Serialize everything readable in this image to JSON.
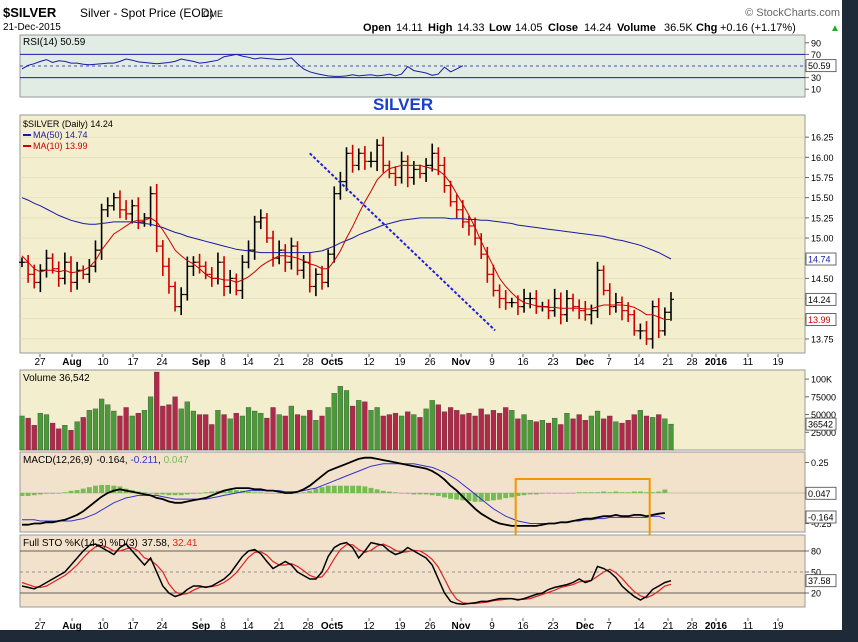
{
  "header": {
    "symbol": "$SILVER",
    "description": "Silver - Spot Price (EOD)",
    "exchange": "CME",
    "date": "21-Dec-2015",
    "copyright": "© StockCharts.com",
    "open_label": "Open",
    "open": "14.11",
    "high_label": "High",
    "high": "14.33",
    "low_label": "Low",
    "low": "14.05",
    "close_label": "Close",
    "close": "14.24",
    "volume_label": "Volume",
    "volume": "36.5K",
    "chg_label": "Chg",
    "chg": "+0.16 (+1.17%)",
    "up_arrow": "▲"
  },
  "annotation": "SILVER",
  "colors": {
    "page_bg": "#ffffff",
    "frame": "#1f2a38",
    "price_up": "#000000",
    "price_down": "#cc0000",
    "ma50": "#1a1aa8",
    "ma10": "#cc0000",
    "trendline": "#1f1fe0",
    "vol_up": "#4a9a3a",
    "vol_down": "#b0284a",
    "macd": "#000000",
    "macd_signal": "#3333cc",
    "macd_hist": "#77bb55",
    "sto_k": "#000000",
    "sto_d": "#dd2222",
    "highlight_box": "#f09800"
  },
  "x_axis_labels": [
    "27",
    "Aug",
    "10",
    "17",
    "24",
    "Sep",
    "8",
    "14",
    "21",
    "28",
    "Oct5",
    "12",
    "19",
    "26",
    "Nov",
    "9",
    "16",
    "23",
    "Dec",
    "7",
    "14",
    "21",
    "28",
    "2016",
    "11",
    "19"
  ],
  "chart_data": [
    {
      "type": "line",
      "title": "RSI(14) 50.59",
      "legend": [
        {
          "name": "RSI(14)",
          "value": "50.59"
        }
      ],
      "y_ticks": [
        "90",
        "70",
        "50",
        "30",
        "10"
      ],
      "y_levels": [
        90,
        70,
        50,
        30,
        10
      ],
      "ylim": [
        0,
        100
      ],
      "reference_lines": [
        70,
        30
      ],
      "last_value_label": "50.59",
      "last_value": 50.59,
      "series": [
        {
          "values": [
            45,
            51,
            54,
            58,
            61,
            56,
            59,
            58,
            55,
            55,
            53,
            52,
            53,
            54,
            55,
            55,
            58,
            62,
            60,
            57,
            56,
            55,
            54,
            55,
            56,
            58,
            62,
            60,
            58,
            55,
            56,
            58,
            60,
            66,
            68,
            70,
            67,
            65,
            62,
            64,
            63,
            62,
            61,
            62,
            64,
            54,
            45,
            40,
            37,
            35,
            33,
            32,
            32,
            33,
            35,
            33,
            34,
            35,
            33,
            34,
            36,
            33,
            36,
            49,
            42,
            40,
            38,
            34,
            36,
            48,
            40,
            45,
            50.59
          ]
        }
      ]
    },
    {
      "type": "line",
      "subtype": "ohlc",
      "legend": [
        {
          "name": "$SILVER (Daily)",
          "value": "14.24"
        },
        {
          "name": "MA(50)",
          "value": "14.74"
        },
        {
          "name": "MA(10)",
          "value": "13.99"
        }
      ],
      "y_ticks": [
        "16.25",
        "16.00",
        "15.75",
        "15.50",
        "15.25",
        "15.00",
        "14.75",
        "14.50",
        "14.25",
        "14.00",
        "13.75"
      ],
      "y_levels": [
        16.25,
        16.0,
        15.75,
        15.5,
        15.25,
        15.0,
        14.75,
        14.5,
        14.25,
        14.0,
        13.75
      ],
      "ylim": [
        13.6,
        16.5
      ],
      "price_tag": "14.24",
      "ma50_tag": "14.74",
      "ma10_tag": "13.99",
      "trendline": {
        "from": {
          "bar": 47,
          "price": 16.05
        },
        "to": {
          "bar": 74,
          "price": 13.93
        }
      },
      "closes": [
        14.7,
        14.55,
        14.45,
        14.6,
        14.75,
        14.62,
        14.5,
        14.7,
        14.45,
        14.6,
        14.55,
        14.65,
        14.85,
        15.35,
        15.4,
        15.5,
        15.35,
        15.3,
        15.4,
        15.2,
        15.25,
        15.55,
        14.9,
        14.65,
        14.4,
        14.15,
        14.3,
        14.65,
        14.7,
        14.65,
        14.55,
        14.5,
        14.7,
        14.4,
        14.5,
        14.35,
        14.7,
        14.85,
        15.2,
        15.25,
        15.0,
        14.75,
        14.85,
        14.7,
        14.9,
        14.6,
        14.7,
        14.4,
        14.55,
        14.45,
        14.8,
        15.55,
        15.7,
        16.05,
        15.9,
        16.05,
        15.95,
        15.95,
        16.15,
        15.9,
        15.8,
        15.75,
        15.95,
        15.75,
        15.85,
        15.8,
        15.9,
        16.05,
        15.9,
        15.65,
        15.45,
        15.35,
        15.2,
        15.15,
        15.0,
        14.8,
        14.55,
        14.35,
        14.25,
        14.2,
        14.2,
        14.15,
        14.25,
        14.25,
        14.15,
        14.15,
        14.1,
        14.25,
        14.05,
        14.25,
        14.15,
        14.1,
        14.05,
        14.1,
        14.6,
        14.35,
        14.15,
        14.2,
        14.1,
        14.05,
        13.85,
        13.85,
        13.75,
        14.15,
        13.85,
        14.08,
        14.24
      ],
      "ma10": [
        14.78,
        14.7,
        14.62,
        14.58,
        14.6,
        14.6,
        14.58,
        14.6,
        14.57,
        14.58,
        14.6,
        14.64,
        14.72,
        14.85,
        14.95,
        15.05,
        15.1,
        15.15,
        15.2,
        15.22,
        15.22,
        15.25,
        15.2,
        15.1,
        14.98,
        14.85,
        14.78,
        14.72,
        14.68,
        14.62,
        14.55,
        14.5,
        14.5,
        14.48,
        14.48,
        14.45,
        14.48,
        14.52,
        14.58,
        14.65,
        14.7,
        14.74,
        14.78,
        14.78,
        14.77,
        14.75,
        14.72,
        14.68,
        14.66,
        14.62,
        14.62,
        14.72,
        14.84,
        15.0,
        15.14,
        15.3,
        15.45,
        15.58,
        15.72,
        15.8,
        15.86,
        15.88,
        15.9,
        15.9,
        15.9,
        15.9,
        15.88,
        15.86,
        15.84,
        15.78,
        15.68,
        15.55,
        15.42,
        15.28,
        15.13,
        14.96,
        14.8,
        14.65,
        14.5,
        14.4,
        14.32,
        14.25,
        14.2,
        14.18,
        14.16,
        14.15,
        14.14,
        14.14,
        14.13,
        14.13,
        14.13,
        14.13,
        14.12,
        14.12,
        14.15,
        14.17,
        14.17,
        14.17,
        14.17,
        14.16,
        14.14,
        14.1,
        14.05,
        14.05,
        14.02,
        13.99,
        13.99
      ],
      "ma50": [
        15.5,
        15.47,
        15.43,
        15.4,
        15.36,
        15.32,
        15.28,
        15.25,
        15.22,
        15.2,
        15.18,
        15.17,
        15.17,
        15.18,
        15.19,
        15.2,
        15.2,
        15.2,
        15.2,
        15.19,
        15.18,
        15.17,
        15.15,
        15.13,
        15.1,
        15.07,
        15.05,
        15.02,
        15.0,
        14.98,
        14.96,
        14.94,
        14.92,
        14.9,
        14.88,
        14.86,
        14.85,
        14.84,
        14.83,
        14.82,
        14.82,
        14.82,
        14.82,
        14.82,
        14.82,
        14.82,
        14.82,
        14.82,
        14.83,
        14.84,
        14.87,
        14.9,
        14.94,
        14.97,
        15.0,
        15.04,
        15.07,
        15.1,
        15.13,
        15.16,
        15.18,
        15.2,
        15.22,
        15.23,
        15.24,
        15.25,
        15.25,
        15.25,
        15.25,
        15.25,
        15.24,
        15.24,
        15.24,
        15.23,
        15.23,
        15.22,
        15.22,
        15.21,
        15.2,
        15.19,
        15.18,
        15.16,
        15.15,
        15.14,
        15.13,
        15.12,
        15.11,
        15.1,
        15.09,
        15.08,
        15.07,
        15.06,
        15.05,
        15.04,
        15.03,
        15.02,
        15.0,
        14.98,
        14.97,
        14.95,
        14.93,
        14.91,
        14.88,
        14.85,
        14.82,
        14.78,
        14.74
      ]
    },
    {
      "type": "bar",
      "title": "Volume 36,542",
      "legend": [
        {
          "name": "Volume",
          "value": "36,542"
        }
      ],
      "y_ticks": [
        "100K",
        "75000",
        "50000",
        "25000"
      ],
      "y_levels": [
        100000,
        75000,
        50000,
        25000
      ],
      "ylim": [
        0,
        110000
      ],
      "last_value_label": "36542",
      "values": [
        48000,
        45000,
        35000,
        52000,
        50000,
        38000,
        30000,
        35000,
        28000,
        40000,
        46000,
        56000,
        58000,
        72000,
        64000,
        55000,
        48000,
        60000,
        48000,
        52000,
        56000,
        75000,
        110000,
        62000,
        64000,
        75000,
        58000,
        68000,
        55000,
        50000,
        50000,
        36000,
        56000,
        50000,
        44000,
        52000,
        48000,
        60000,
        55000,
        52000,
        45000,
        60000,
        50000,
        48000,
        62000,
        50000,
        48000,
        56000,
        42000,
        48000,
        60000,
        80000,
        90000,
        84000,
        62000,
        70000,
        68000,
        56000,
        60000,
        48000,
        50000,
        52000,
        48000,
        54000,
        50000,
        46000,
        58000,
        70000,
        64000,
        54000,
        60000,
        56000,
        50000,
        52000,
        48000,
        58000,
        50000,
        56000,
        52000,
        60000,
        56000,
        44000,
        50000,
        42000,
        40000,
        42000,
        38000,
        45000,
        36000,
        52000,
        44000,
        50000,
        42000,
        48000,
        55000,
        44000,
        48000,
        40000,
        38000,
        42000,
        50000,
        56000,
        48000,
        46000,
        50000,
        44000,
        36542
      ]
    },
    {
      "type": "line",
      "title": "MACD(12,26,9) -0.164, -0.211, 0.047",
      "legend": [
        {
          "name": "MACD(12,26,9)",
          "value": "-0.164"
        },
        {
          "name": "signal",
          "value": "-0.211"
        },
        {
          "name": "histogram",
          "value": "0.047"
        }
      ],
      "y_ticks": [
        "0.25",
        "0.00",
        "-0.25"
      ],
      "y_levels": [
        0.25,
        0.0,
        -0.25
      ],
      "ylim": [
        -0.32,
        0.32
      ],
      "hist_tag": "0.047",
      "macd_tag": "-0.164",
      "macd": [
        -0.26,
        -0.26,
        -0.25,
        -0.25,
        -0.24,
        -0.24,
        -0.23,
        -0.22,
        -0.2,
        -0.18,
        -0.15,
        -0.11,
        -0.07,
        -0.03,
        0.0,
        0.02,
        0.03,
        0.02,
        0.01,
        0.0,
        -0.01,
        -0.02,
        -0.04,
        -0.05,
        -0.07,
        -0.08,
        -0.08,
        -0.07,
        -0.06,
        -0.05,
        -0.04,
        -0.02,
        0.0,
        0.02,
        0.03,
        0.04,
        0.04,
        0.04,
        0.03,
        0.03,
        0.02,
        0.02,
        0.01,
        0.0,
        0.0,
        0.01,
        0.03,
        0.06,
        0.1,
        0.14,
        0.18,
        0.2,
        0.22,
        0.24,
        0.26,
        0.28,
        0.29,
        0.29,
        0.28,
        0.27,
        0.26,
        0.25,
        0.24,
        0.23,
        0.22,
        0.21,
        0.2,
        0.18,
        0.15,
        0.11,
        0.06,
        0.02,
        -0.03,
        -0.08,
        -0.13,
        -0.17,
        -0.2,
        -0.23,
        -0.25,
        -0.26,
        -0.27,
        -0.27,
        -0.27,
        -0.27,
        -0.27,
        -0.26,
        -0.25,
        -0.25,
        -0.24,
        -0.24,
        -0.23,
        -0.22,
        -0.21,
        -0.21,
        -0.2,
        -0.19,
        -0.19,
        -0.18,
        -0.19,
        -0.19,
        -0.18,
        -0.18,
        -0.19,
        -0.18,
        -0.17,
        -0.164
      ],
      "signal": [
        -0.22,
        -0.22,
        -0.22,
        -0.23,
        -0.23,
        -0.23,
        -0.23,
        -0.23,
        -0.23,
        -0.22,
        -0.21,
        -0.19,
        -0.17,
        -0.14,
        -0.11,
        -0.08,
        -0.06,
        -0.04,
        -0.03,
        -0.02,
        -0.02,
        -0.02,
        -0.02,
        -0.03,
        -0.04,
        -0.05,
        -0.05,
        -0.05,
        -0.05,
        -0.05,
        -0.05,
        -0.04,
        -0.03,
        -0.02,
        -0.01,
        0.0,
        0.01,
        0.02,
        0.02,
        0.02,
        0.02,
        0.02,
        0.02,
        0.01,
        0.01,
        0.01,
        0.02,
        0.03,
        0.04,
        0.06,
        0.08,
        0.1,
        0.12,
        0.14,
        0.16,
        0.18,
        0.2,
        0.22,
        0.23,
        0.24,
        0.24,
        0.24,
        0.24,
        0.24,
        0.24,
        0.23,
        0.22,
        0.21,
        0.19,
        0.17,
        0.14,
        0.11,
        0.07,
        0.03,
        -0.01,
        -0.05,
        -0.09,
        -0.13,
        -0.16,
        -0.19,
        -0.21,
        -0.23,
        -0.24,
        -0.25,
        -0.25,
        -0.25,
        -0.25,
        -0.25,
        -0.24,
        -0.24,
        -0.23,
        -0.23,
        -0.22,
        -0.22,
        -0.21,
        -0.21,
        -0.2,
        -0.2,
        -0.2,
        -0.2,
        -0.2,
        -0.2,
        -0.2,
        -0.19,
        -0.19,
        -0.211
      ]
    },
    {
      "type": "line",
      "title": "Full STO %K(14,3) %D(3) 37.58, 32.41",
      "legend": [
        {
          "name": "Full STO %K(14,3) %D(3)",
          "value": "37.58"
        },
        {
          "name": "%D",
          "value": "32.41"
        }
      ],
      "y_ticks": [
        "80",
        "50",
        "20"
      ],
      "y_levels": [
        80,
        50,
        20
      ],
      "ylim": [
        0,
        100
      ],
      "reference_lines": [
        80,
        50,
        20
      ],
      "k_tag": "37.58",
      "k": [
        30,
        28,
        26,
        30,
        35,
        40,
        45,
        50,
        60,
        70,
        80,
        88,
        90,
        85,
        80,
        75,
        85,
        90,
        80,
        70,
        60,
        70,
        50,
        30,
        20,
        15,
        18,
        25,
        30,
        30,
        28,
        30,
        35,
        40,
        48,
        60,
        72,
        80,
        82,
        76,
        65,
        55,
        60,
        65,
        60,
        50,
        45,
        40,
        40,
        50,
        72,
        85,
        90,
        92,
        85,
        70,
        80,
        92,
        90,
        88,
        80,
        75,
        78,
        85,
        80,
        75,
        70,
        60,
        40,
        20,
        8,
        5,
        4,
        5,
        6,
        8,
        8,
        10,
        12,
        12,
        12,
        10,
        12,
        15,
        18,
        20,
        25,
        28,
        30,
        32,
        35,
        40,
        35,
        38,
        58,
        55,
        50,
        42,
        30,
        22,
        15,
        10,
        15,
        25,
        30,
        35,
        37.58
      ],
      "d": [
        35,
        32,
        29,
        28,
        30,
        35,
        40,
        45,
        52,
        60,
        70,
        79,
        86,
        88,
        85,
        80,
        80,
        83,
        85,
        80,
        70,
        67,
        60,
        50,
        33,
        22,
        18,
        19,
        24,
        28,
        29,
        29,
        31,
        35,
        41,
        49,
        60,
        71,
        78,
        79,
        74,
        65,
        60,
        60,
        62,
        58,
        52,
        45,
        42,
        43,
        54,
        69,
        82,
        89,
        89,
        82,
        78,
        81,
        87,
        90,
        86,
        81,
        78,
        79,
        81,
        80,
        75,
        68,
        57,
        40,
        23,
        11,
        6,
        5,
        5,
        6,
        7,
        9,
        10,
        11,
        12,
        11,
        11,
        12,
        15,
        18,
        21,
        24,
        28,
        30,
        32,
        36,
        37,
        38,
        44,
        50,
        54,
        49,
        41,
        31,
        22,
        16,
        13,
        17,
        23,
        30,
        32.41
      ]
    }
  ]
}
